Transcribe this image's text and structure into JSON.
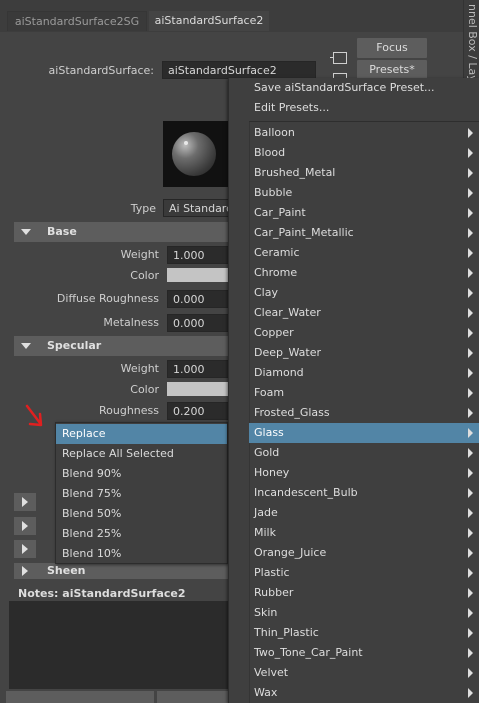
{
  "tabs": [
    {
      "label": "aiStandardSurface2SG"
    },
    {
      "label": "aiStandardSurface2"
    }
  ],
  "side_strip_text": "nnel Box / Laye",
  "node": {
    "label": "aiStandardSurface:",
    "value": "aiStandardSurface2",
    "focus_label": "Focus",
    "presets_label": "Presets*"
  },
  "type_row": {
    "label": "Type",
    "value": "Ai Standard"
  },
  "sections": {
    "base": {
      "title": "Base",
      "weight_label": "Weight",
      "weight_value": "1.000",
      "color_label": "Color",
      "diffuse_roughness_label": "Diffuse Roughness",
      "diffuse_roughness_value": "0.000",
      "metalness_label": "Metalness",
      "metalness_value": "0.000"
    },
    "specular": {
      "title": "Specular",
      "weight_label": "Weight",
      "weight_value": "1.000",
      "color_label": "Color",
      "roughness_label": "Roughness",
      "roughness_value": "0.200"
    },
    "sheen": {
      "title": "Sheen"
    }
  },
  "blend_menu": {
    "items": [
      "Replace",
      "Replace All Selected",
      "Blend 90%",
      "Blend 75%",
      "Blend 50%",
      "Blend 25%",
      "Blend 10%"
    ],
    "highlighted": "Replace"
  },
  "presets_menu": {
    "actions": [
      "Save aiStandardSurface Preset...",
      "Edit Presets..."
    ],
    "items": [
      "Balloon",
      "Blood",
      "Brushed_Metal",
      "Bubble",
      "Car_Paint",
      "Car_Paint_Metallic",
      "Ceramic",
      "Chrome",
      "Clay",
      "Clear_Water",
      "Copper",
      "Deep_Water",
      "Diamond",
      "Foam",
      "Frosted_Glass",
      "Glass",
      "Gold",
      "Honey",
      "Incandescent_Bulb",
      "Jade",
      "Milk",
      "Orange_Juice",
      "Plastic",
      "Rubber",
      "Skin",
      "Thin_Plastic",
      "Two_Tone_Car_Paint",
      "Velvet",
      "Wax"
    ],
    "highlighted": "Glass"
  },
  "notes": {
    "label": "Notes:",
    "value": "aiStandardSurface2"
  },
  "colors": {
    "panel_bg": "#444444",
    "highlight": "#5285a6",
    "section_header": "#5d5d5d",
    "field_bg": "#2b2b2b",
    "annotation_arrow": "#e02020"
  },
  "icons": [
    "square-select-icon",
    "material-preview-sphere",
    "expand-triangle-icon",
    "collapse-triangle-icon",
    "submenu-arrow-icon",
    "red-pointer-arrow-icon"
  ]
}
